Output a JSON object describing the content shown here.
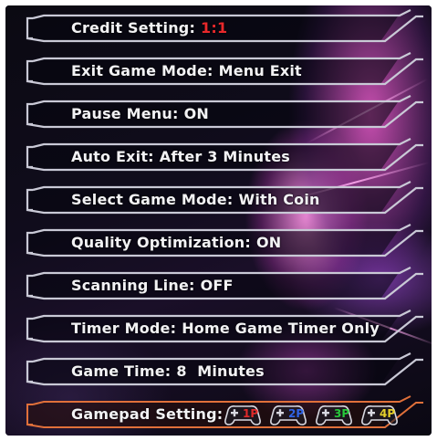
{
  "menu": {
    "items": [
      {
        "label": "Credit Setting:",
        "value": "1:1",
        "value_color": "#e8282b"
      },
      {
        "label": "Exit Game Mode:",
        "value": "Menu Exit"
      },
      {
        "label": "Pause Menu:",
        "value": "ON"
      },
      {
        "label": "Auto Exit:",
        "value": "After 3 Minutes"
      },
      {
        "label": "Select Game Mode:",
        "value": "With Coin"
      },
      {
        "label": "Quality Optimization:",
        "value": "ON"
      },
      {
        "label": "Scanning Line:",
        "value": "OFF"
      },
      {
        "label": "Timer Mode:",
        "value": "Home Game Timer Only"
      },
      {
        "label": "Game Time:",
        "value": "8  Minutes"
      }
    ],
    "gamepad": {
      "label": "Gamepad Setting:",
      "pads": [
        {
          "label": "1P",
          "color": "#e02a2a"
        },
        {
          "label": "2P",
          "color": "#2f63e6"
        },
        {
          "label": "3P",
          "color": "#26c93a"
        },
        {
          "label": "4P",
          "color": "#e6d02a"
        }
      ]
    }
  },
  "colors": {
    "frame_normal": "#c9c9d6",
    "frame_selected": "#e0703a"
  }
}
